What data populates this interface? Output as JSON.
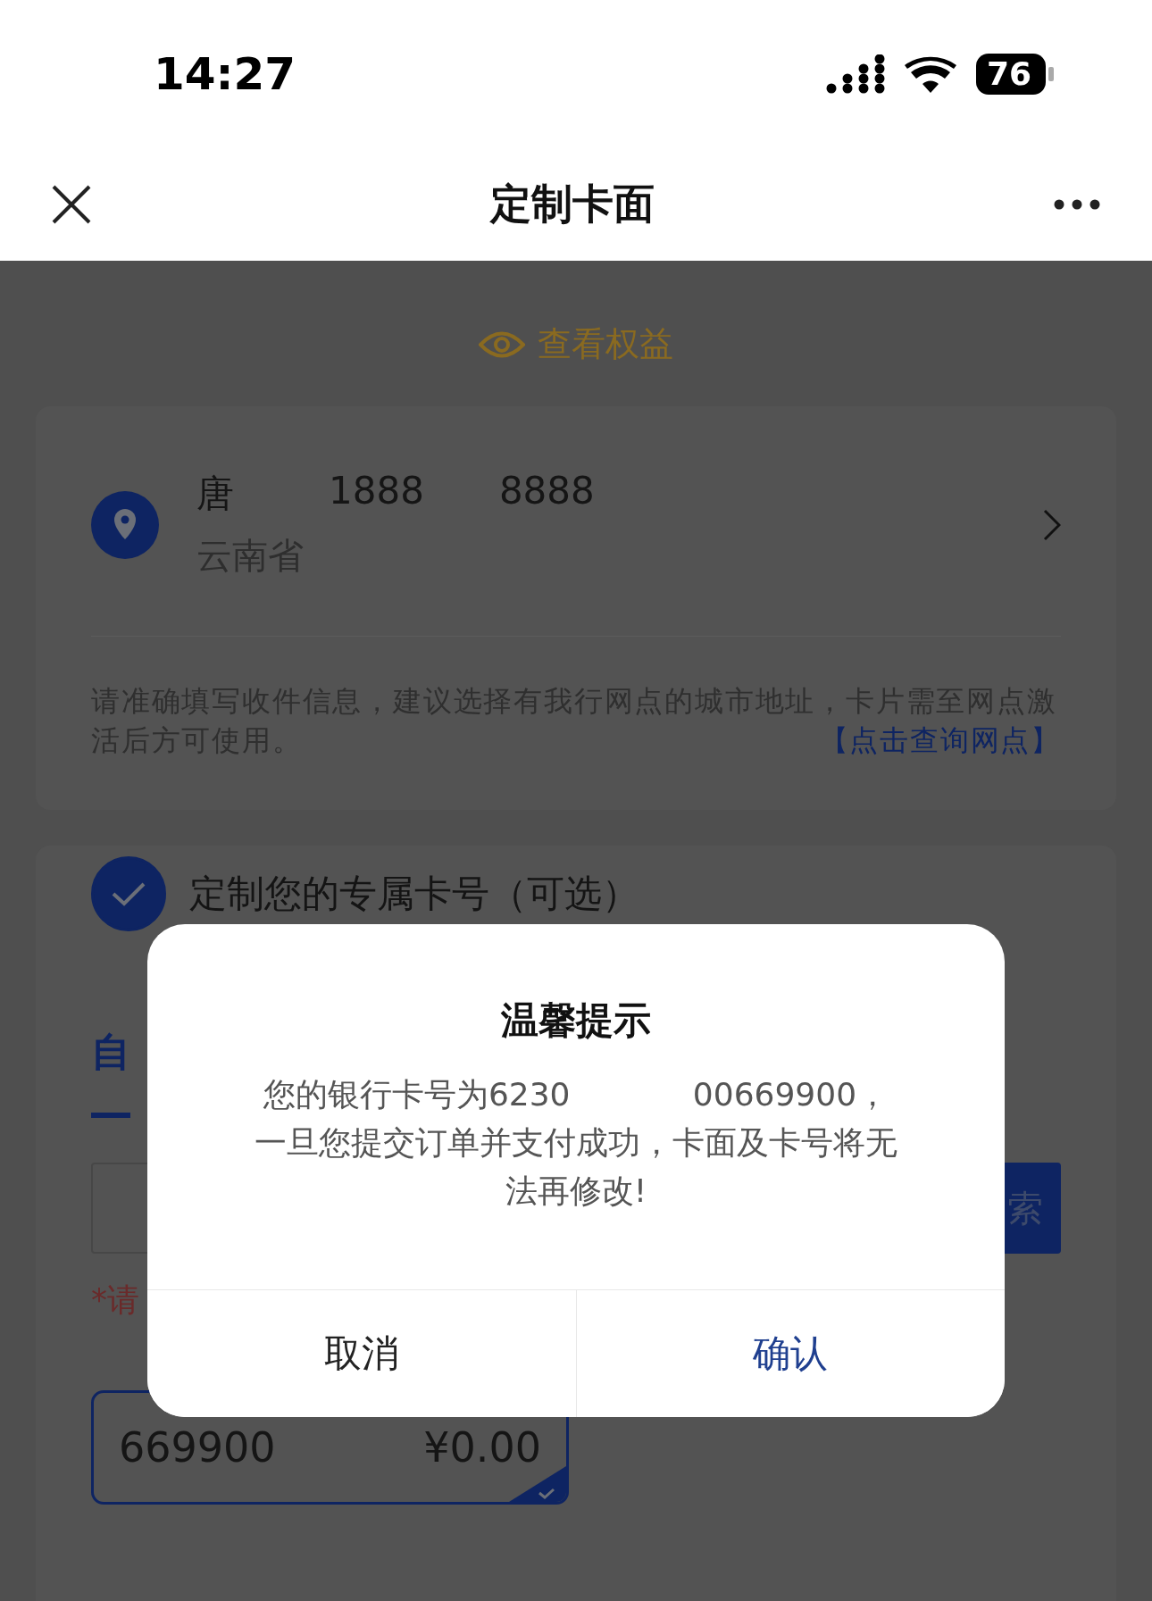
{
  "status_bar": {
    "time": "14:27",
    "battery": "76"
  },
  "nav": {
    "title": "定制卡面"
  },
  "benefits_link": "查看权益",
  "address_card": {
    "name": "唐",
    "phone_parts": [
      "1888",
      "8888"
    ],
    "region": "云南省",
    "notice": "请准确填写收件信息，建议选择有我行网点的城市地址，卡片需至网点激活后方可使用。",
    "notice_link": "【点击查询网点】"
  },
  "number_card": {
    "checked": true,
    "title": "定制您的专属卡号（可选）",
    "tab": "自",
    "search_button": "索",
    "hint": "*请",
    "option": {
      "number": "669900",
      "price": "¥0.00",
      "selected": true
    }
  },
  "dialog": {
    "title": "温馨提示",
    "message_lines": [
      "您的银行卡号为6230            00669900，",
      "一旦您提交订单并支付成功，卡面及卡号将无",
      "法再修改!"
    ],
    "buttons": [
      {
        "label": "取消",
        "kind": "cancel"
      },
      {
        "label": "确认",
        "kind": "confirm"
      }
    ]
  }
}
